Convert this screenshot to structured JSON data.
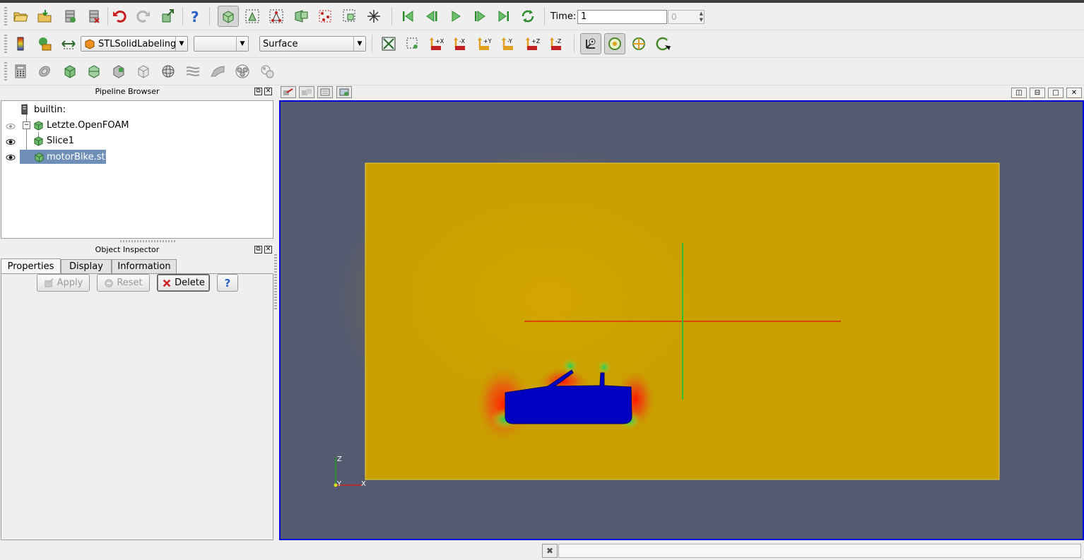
{
  "toolbar_main": {
    "time_label": "Time:",
    "time_value": "1",
    "timestep_value": "0"
  },
  "toolbar_display": {
    "coloring_value": "STLSolidLabeling",
    "component_value": "",
    "representation_value": "Surface",
    "view_buttons": [
      "+X",
      "-X",
      "+Y",
      "-Y",
      "+Z",
      "-Z"
    ]
  },
  "pipeline_browser": {
    "title": "Pipeline Browser",
    "items": [
      {
        "label": "builtin:"
      },
      {
        "label": "Letzte.OpenFOAM"
      },
      {
        "label": "Slice1"
      },
      {
        "label": "motorBike.stl"
      }
    ]
  },
  "object_inspector": {
    "title": "Object Inspector",
    "tabs": [
      {
        "label": "Properties"
      },
      {
        "label": "Display"
      },
      {
        "label": "Information"
      }
    ],
    "apply_label": "Apply",
    "reset_label": "Reset",
    "delete_label": "Delete"
  },
  "viewport": {
    "axis_labels": {
      "z": "Z",
      "y": "Y",
      "x": "X"
    }
  },
  "colors": {
    "viewport_bg": "#545a70",
    "slice_field": "#c9a000",
    "body": "#0000c0",
    "selection": "#6f8fb8",
    "active_border": "#0000d8"
  }
}
